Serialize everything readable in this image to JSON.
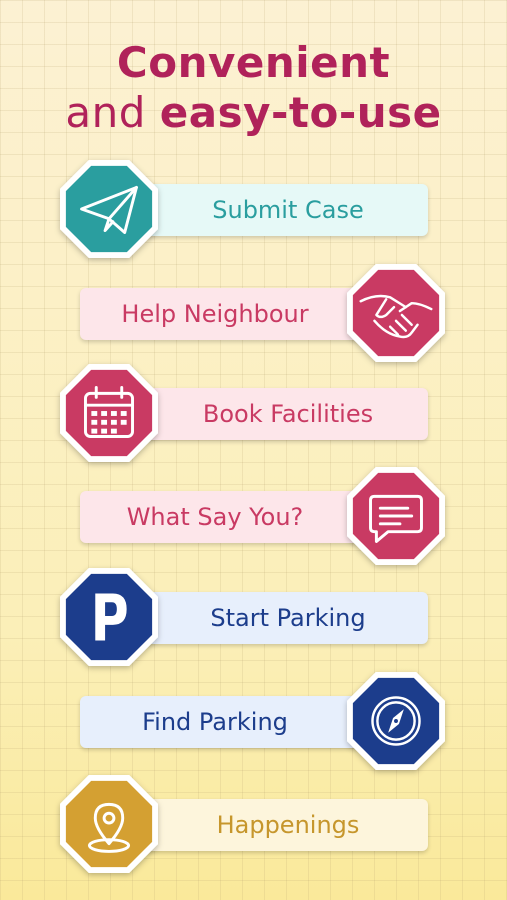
{
  "headline": {
    "line1": "Convenient",
    "line2_normal": "and",
    "line2_bold": "easy-to-use"
  },
  "features": [
    {
      "label": "Submit Case",
      "icon": "paper-plane-icon",
      "side": "left",
      "color": "#2a9e9f",
      "text_color": "#2a9e9f",
      "pill_bg": "#e6f9f7"
    },
    {
      "label": "Help Neighbour",
      "icon": "handshake-icon",
      "side": "right",
      "color": "#c93a63",
      "text_color": "#c93a63",
      "pill_bg": "#fde6ea"
    },
    {
      "label": "Book Facilities",
      "icon": "calendar-icon",
      "side": "left",
      "color": "#c93a63",
      "text_color": "#c93a63",
      "pill_bg": "#fde6ea"
    },
    {
      "label": "What Say You?",
      "icon": "chat-bubble-icon",
      "side": "right",
      "color": "#c93a63",
      "text_color": "#c93a63",
      "pill_bg": "#fde6ea"
    },
    {
      "label": "Start Parking",
      "icon": "parking-icon",
      "side": "left",
      "color": "#1c3d8c",
      "text_color": "#1c3d8c",
      "pill_bg": "#e7effc"
    },
    {
      "label": "Find Parking",
      "icon": "compass-icon",
      "side": "right",
      "color": "#1c3d8c",
      "text_color": "#1c3d8c",
      "pill_bg": "#e7effc"
    },
    {
      "label": "Happenings",
      "icon": "location-pin-icon",
      "side": "left",
      "color": "#d4a032",
      "text_color": "#c6962c",
      "pill_bg": "#fdf5dc"
    }
  ]
}
